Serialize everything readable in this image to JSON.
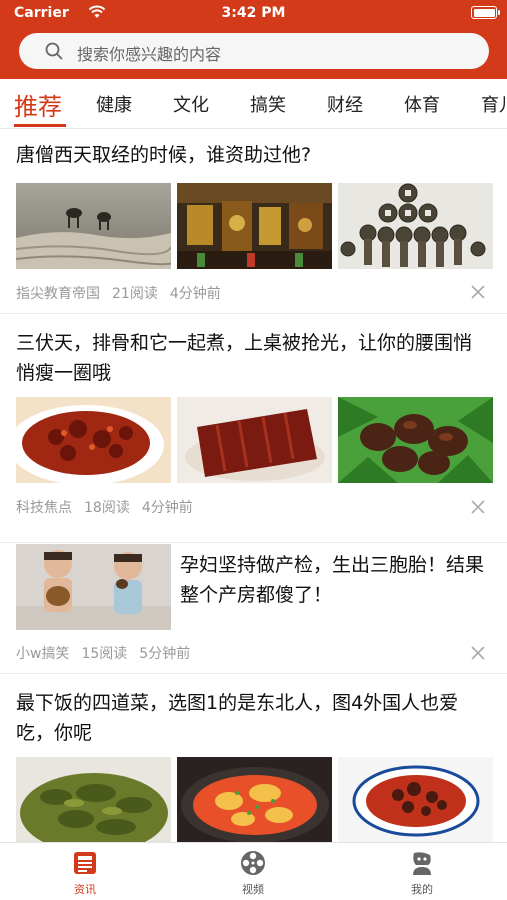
{
  "status_bar": {
    "carrier": "Carrier",
    "time": "3:42 PM"
  },
  "search": {
    "placeholder": "搜索你感兴趣的内容"
  },
  "tabs": [
    "推荐",
    "健康",
    "文化",
    "搞笑",
    "财经",
    "体育",
    "育儿"
  ],
  "feed": [
    {
      "title": "唐僧西天取经的时候，谁资助过他?",
      "source": "指尖教育帝国",
      "reads": "21阅读",
      "time": "4分钟前"
    },
    {
      "title": "三伏天，排骨和它一起煮，上桌被抢光，让你的腰围悄悄瘦一圈哦",
      "source": "科技焦点",
      "reads": "18阅读",
      "time": "4分钟前"
    },
    {
      "title": "孕妇坚持做产检，生出三胞胎！结果整个产房都傻了！",
      "source": "小w搞笑",
      "reads": "15阅读",
      "time": "5分钟前"
    },
    {
      "title": "最下饭的四道菜，选图1的是东北人，图4外国人也爱吃，你呢"
    }
  ],
  "tabbar": [
    {
      "label": "资讯",
      "icon": "news-icon"
    },
    {
      "label": "视频",
      "icon": "video-reel-icon"
    },
    {
      "label": "我的",
      "icon": "profile-icon"
    }
  ],
  "colors": {
    "accent": "#d33a19"
  }
}
